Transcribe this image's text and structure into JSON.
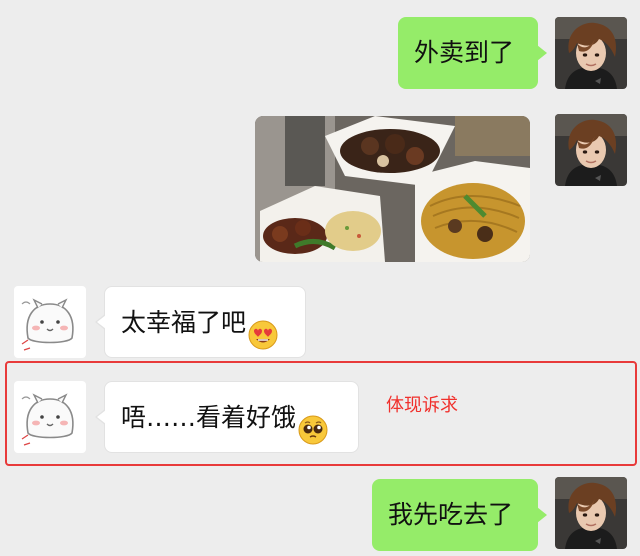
{
  "chat": {
    "messages": [
      {
        "sender": "self",
        "type": "text",
        "text": "外卖到了"
      },
      {
        "sender": "self",
        "type": "image",
        "image_icon": "takeout-food-photo"
      },
      {
        "sender": "friend",
        "type": "text",
        "text": "太幸福了吧",
        "emoji": "heart-eyes-emoji"
      },
      {
        "sender": "friend",
        "type": "text",
        "text": "唔……看着好饿",
        "emoji": "pleading-face-emoji"
      },
      {
        "sender": "self",
        "type": "text",
        "text": "我先吃去了"
      }
    ]
  },
  "annotation": {
    "label": "体现诉求",
    "color": "#f0302c"
  },
  "colors": {
    "background": "#ededed",
    "sent_bubble": "#95ec69",
    "received_bubble": "#ffffff",
    "highlight_border": "#e83a3a"
  }
}
